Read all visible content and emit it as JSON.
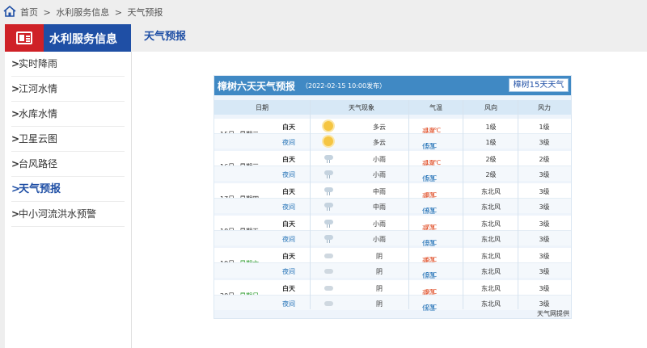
{
  "breadcrumb": {
    "home": "首页",
    "sep": ">",
    "level1": "水利服务信息",
    "level2": "天气预报"
  },
  "sidebar": {
    "title": "水利服务信息",
    "items": [
      {
        "label": "实时降雨",
        "active": false
      },
      {
        "label": "江河水情",
        "active": false
      },
      {
        "label": "水库水情",
        "active": false
      },
      {
        "label": "卫星云图",
        "active": false
      },
      {
        "label": "台风路径",
        "active": false
      },
      {
        "label": "天气预报",
        "active": true
      },
      {
        "label": "中小河流洪水预警",
        "active": false
      }
    ],
    "chevron": ">"
  },
  "page_tab": "天气预报",
  "forecast": {
    "title": "樟树六天天气预报",
    "published": "（2022-02-15 10:00发布）",
    "btn15": "樟树15天天气",
    "headers": {
      "date": "日期",
      "phenomenon": "天气现象",
      "temp": "气温",
      "wind_dir": "风向",
      "wind_force": "风力"
    },
    "day_label": "白天",
    "night_label": "夜间",
    "hi_label": "高温",
    "lo_label": "低温",
    "days": [
      {
        "date": "15日",
        "weekday": "星期二",
        "weekend": false,
        "day": {
          "icon": "sun-cloud-icon",
          "phen": "多云",
          "temp": "10℃",
          "wind": "1级",
          "force": "1级"
        },
        "night": {
          "icon": "sun-cloud-icon",
          "phen": "多云",
          "temp": "5℃",
          "wind": "1级",
          "force": "3级"
        }
      },
      {
        "date": "16日",
        "weekday": "星期三",
        "weekend": false,
        "day": {
          "icon": "rain-icon",
          "phen": "小雨",
          "temp": "10℃",
          "wind": "2级",
          "force": "2级"
        },
        "night": {
          "icon": "rain-icon",
          "phen": "小雨",
          "temp": "5℃",
          "wind": "2级",
          "force": "3级"
        }
      },
      {
        "date": "17日",
        "weekday": "星期四",
        "weekend": false,
        "day": {
          "icon": "rain-icon",
          "phen": "中雨",
          "temp": "8℃",
          "wind": "东北风",
          "force": "3级"
        },
        "night": {
          "icon": "rain-icon",
          "phen": "中雨",
          "temp": "4℃",
          "wind": "东北风",
          "force": "3级"
        }
      },
      {
        "date": "18日",
        "weekday": "星期五",
        "weekend": false,
        "day": {
          "icon": "rain-icon",
          "phen": "小雨",
          "temp": "7℃",
          "wind": "东北风",
          "force": "3级"
        },
        "night": {
          "icon": "rain-icon",
          "phen": "小雨",
          "temp": "3℃",
          "wind": "东北风",
          "force": "3级"
        }
      },
      {
        "date": "19日",
        "weekday": "星期六",
        "weekend": true,
        "day": {
          "icon": "cloud-icon",
          "phen": "阴",
          "temp": "6℃",
          "wind": "东北风",
          "force": "3级"
        },
        "night": {
          "icon": "cloud-icon",
          "phen": "阴",
          "temp": "3℃",
          "wind": "东北风",
          "force": "3级"
        }
      },
      {
        "date": "20日",
        "weekday": "星期日",
        "weekend": true,
        "day": {
          "icon": "cloud-icon",
          "phen": "阴",
          "temp": "9℃",
          "wind": "东北风",
          "force": "3级"
        },
        "night": {
          "icon": "cloud-icon",
          "phen": "阴",
          "temp": "2℃",
          "wind": "东北风",
          "force": "3级"
        }
      }
    ],
    "source": "天气网提供"
  },
  "colors": {
    "brand_blue": "#1f4fa5",
    "brand_red": "#cf2127",
    "panel_header": "#4089c4",
    "hi_temp": "#e0502a",
    "lo_temp": "#1f6fb5",
    "weekend": "#2a9a2a"
  }
}
